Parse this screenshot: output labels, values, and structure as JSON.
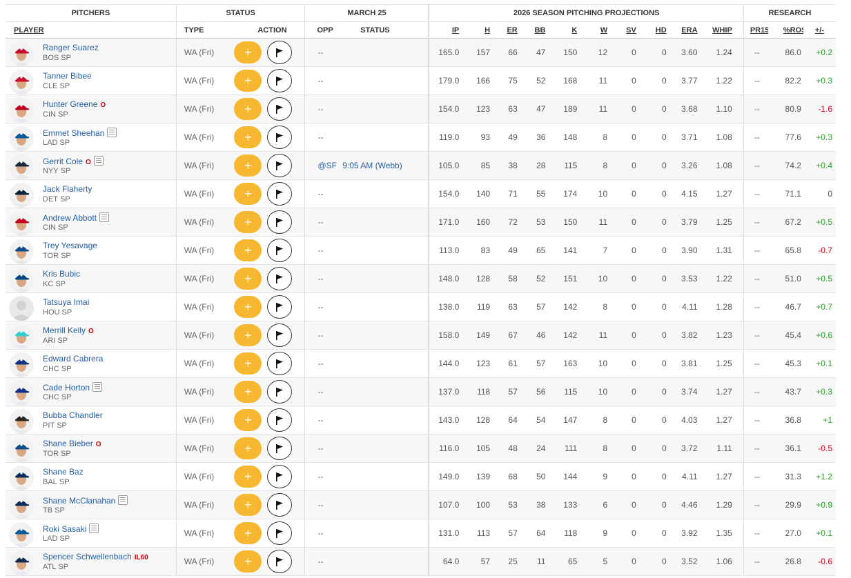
{
  "groups": {
    "pitchers": "PITCHERS",
    "status": "STATUS",
    "date": "MARCH 25",
    "projections": "2026 SEASON PITCHING PROJECTIONS",
    "research": "RESEARCH"
  },
  "columns": {
    "player": "PLAYER",
    "type": "TYPE",
    "action": "ACTION",
    "opp": "OPP",
    "status": "STATUS",
    "ip": "IP",
    "h": "H",
    "er": "ER",
    "bb": "BB",
    "k": "K",
    "w": "W",
    "sv": "SV",
    "hd": "HD",
    "era": "ERA",
    "whip": "WHIP",
    "pr15": "PR15",
    "rost": "%ROST",
    "pm": "+/-"
  },
  "action_labels": {
    "add": "+"
  },
  "colors": {
    "add_button": "#f7b731",
    "link": "#225ea8",
    "positive": "#2a9d2a",
    "negative": "#d0021b",
    "injury": "#cc0000"
  },
  "players": [
    {
      "name": "Ranger Suarez",
      "team": "BOS",
      "pos": "SP",
      "tag": "",
      "news": false,
      "type": "WA (Fri)",
      "opp": "--",
      "gstatus": "",
      "ip": "165.0",
      "h": "157",
      "er": "66",
      "bb": "47",
      "k": "150",
      "w": "12",
      "sv": "0",
      "hd": "0",
      "era": "3.60",
      "whip": "1.24",
      "pr15": "--",
      "rost": "86.0",
      "pm": "+0.2",
      "cap": "#c8102e"
    },
    {
      "name": "Tanner Bibee",
      "team": "CLE",
      "pos": "SP",
      "tag": "",
      "news": false,
      "type": "WA (Fri)",
      "opp": "--",
      "gstatus": "",
      "ip": "179.0",
      "h": "166",
      "er": "75",
      "bb": "52",
      "k": "168",
      "w": "11",
      "sv": "0",
      "hd": "0",
      "era": "3.77",
      "whip": "1.22",
      "pr15": "--",
      "rost": "82.2",
      "pm": "+0.3",
      "cap": "#c8102e"
    },
    {
      "name": "Hunter Greene",
      "team": "CIN",
      "pos": "SP",
      "tag": "O",
      "news": false,
      "type": "WA (Fri)",
      "opp": "--",
      "gstatus": "",
      "ip": "154.0",
      "h": "123",
      "er": "63",
      "bb": "47",
      "k": "189",
      "w": "11",
      "sv": "0",
      "hd": "0",
      "era": "3.68",
      "whip": "1.10",
      "pr15": "--",
      "rost": "80.9",
      "pm": "-1.6",
      "cap": "#c6011f"
    },
    {
      "name": "Emmet Sheehan",
      "team": "LAD",
      "pos": "SP",
      "tag": "",
      "news": true,
      "type": "WA (Fri)",
      "opp": "--",
      "gstatus": "",
      "ip": "119.0",
      "h": "93",
      "er": "49",
      "bb": "36",
      "k": "148",
      "w": "8",
      "sv": "0",
      "hd": "0",
      "era": "3.71",
      "whip": "1.08",
      "pr15": "--",
      "rost": "77.6",
      "pm": "+0.3",
      "cap": "#005a9c"
    },
    {
      "name": "Gerrit Cole",
      "team": "NYY",
      "pos": "SP",
      "tag": "O",
      "news": true,
      "type": "WA (Fri)",
      "opp": "@SF",
      "gstatus": "9:05 AM (Webb)",
      "ip": "105.0",
      "h": "85",
      "er": "38",
      "bb": "28",
      "k": "115",
      "w": "8",
      "sv": "0",
      "hd": "0",
      "era": "3.26",
      "whip": "1.08",
      "pr15": "--",
      "rost": "74.2",
      "pm": "+0.4",
      "cap": "#1c2841"
    },
    {
      "name": "Jack Flaherty",
      "team": "DET",
      "pos": "SP",
      "tag": "",
      "news": false,
      "type": "WA (Fri)",
      "opp": "--",
      "gstatus": "",
      "ip": "154.0",
      "h": "140",
      "er": "71",
      "bb": "55",
      "k": "174",
      "w": "10",
      "sv": "0",
      "hd": "0",
      "era": "4.15",
      "whip": "1.27",
      "pr15": "--",
      "rost": "71.1",
      "pm": "0",
      "cap": "#0c2340"
    },
    {
      "name": "Andrew Abbott",
      "team": "CIN",
      "pos": "SP",
      "tag": "",
      "news": true,
      "type": "WA (Fri)",
      "opp": "--",
      "gstatus": "",
      "ip": "171.0",
      "h": "160",
      "er": "72",
      "bb": "53",
      "k": "150",
      "w": "11",
      "sv": "0",
      "hd": "0",
      "era": "3.79",
      "whip": "1.25",
      "pr15": "--",
      "rost": "67.2",
      "pm": "+0.5",
      "cap": "#c6011f"
    },
    {
      "name": "Trey Yesavage",
      "team": "TOR",
      "pos": "SP",
      "tag": "",
      "news": false,
      "type": "WA (Fri)",
      "opp": "--",
      "gstatus": "",
      "ip": "113.0",
      "h": "83",
      "er": "49",
      "bb": "65",
      "k": "141",
      "w": "7",
      "sv": "0",
      "hd": "0",
      "era": "3.90",
      "whip": "1.31",
      "pr15": "--",
      "rost": "65.8",
      "pm": "-0.7",
      "cap": "#134a8e"
    },
    {
      "name": "Kris Bubic",
      "team": "KC",
      "pos": "SP",
      "tag": "",
      "news": false,
      "type": "WA (Fri)",
      "opp": "--",
      "gstatus": "",
      "ip": "148.0",
      "h": "128",
      "er": "58",
      "bb": "52",
      "k": "151",
      "w": "10",
      "sv": "0",
      "hd": "0",
      "era": "3.53",
      "whip": "1.22",
      "pr15": "--",
      "rost": "51.0",
      "pm": "+0.5",
      "cap": "#004687"
    },
    {
      "name": "Tatsuya Imai",
      "team": "HOU",
      "pos": "SP",
      "tag": "",
      "news": false,
      "type": "WA (Fri)",
      "opp": "--",
      "gstatus": "",
      "ip": "138.0",
      "h": "119",
      "er": "63",
      "bb": "57",
      "k": "142",
      "w": "8",
      "sv": "0",
      "hd": "0",
      "era": "4.11",
      "whip": "1.28",
      "pr15": "--",
      "rost": "46.7",
      "pm": "+0.7",
      "cap": ""
    },
    {
      "name": "Merrill Kelly",
      "team": "ARI",
      "pos": "SP",
      "tag": "O",
      "news": false,
      "type": "WA (Fri)",
      "opp": "--",
      "gstatus": "",
      "ip": "158.0",
      "h": "149",
      "er": "67",
      "bb": "46",
      "k": "142",
      "w": "11",
      "sv": "0",
      "hd": "0",
      "era": "3.82",
      "whip": "1.23",
      "pr15": "--",
      "rost": "45.4",
      "pm": "+0.6",
      "cap": "#30ced8"
    },
    {
      "name": "Edward Cabrera",
      "team": "CHC",
      "pos": "SP",
      "tag": "",
      "news": false,
      "type": "WA (Fri)",
      "opp": "--",
      "gstatus": "",
      "ip": "144.0",
      "h": "123",
      "er": "61",
      "bb": "57",
      "k": "163",
      "w": "10",
      "sv": "0",
      "hd": "0",
      "era": "3.81",
      "whip": "1.25",
      "pr15": "--",
      "rost": "45.3",
      "pm": "+0.1",
      "cap": "#0e3386"
    },
    {
      "name": "Cade Horton",
      "team": "CHC",
      "pos": "SP",
      "tag": "",
      "news": true,
      "type": "WA (Fri)",
      "opp": "--",
      "gstatus": "",
      "ip": "137.0",
      "h": "118",
      "er": "57",
      "bb": "56",
      "k": "115",
      "w": "10",
      "sv": "0",
      "hd": "0",
      "era": "3.74",
      "whip": "1.27",
      "pr15": "--",
      "rost": "43.7",
      "pm": "+0.3",
      "cap": "#0e3386"
    },
    {
      "name": "Bubba Chandler",
      "team": "PIT",
      "pos": "SP",
      "tag": "",
      "news": false,
      "type": "WA (Fri)",
      "opp": "--",
      "gstatus": "",
      "ip": "143.0",
      "h": "128",
      "er": "64",
      "bb": "54",
      "k": "147",
      "w": "8",
      "sv": "0",
      "hd": "0",
      "era": "4.03",
      "whip": "1.27",
      "pr15": "--",
      "rost": "36.8",
      "pm": "+1",
      "cap": "#27251f"
    },
    {
      "name": "Shane Bieber",
      "team": "TOR",
      "pos": "SP",
      "tag": "O",
      "news": false,
      "type": "WA (Fri)",
      "opp": "--",
      "gstatus": "",
      "ip": "116.0",
      "h": "105",
      "er": "48",
      "bb": "24",
      "k": "111",
      "w": "8",
      "sv": "0",
      "hd": "0",
      "era": "3.72",
      "whip": "1.11",
      "pr15": "--",
      "rost": "36.1",
      "pm": "-0.5",
      "cap": "#134a8e"
    },
    {
      "name": "Shane Baz",
      "team": "BAL",
      "pos": "SP",
      "tag": "",
      "news": false,
      "type": "WA (Fri)",
      "opp": "--",
      "gstatus": "",
      "ip": "149.0",
      "h": "139",
      "er": "68",
      "bb": "50",
      "k": "144",
      "w": "9",
      "sv": "0",
      "hd": "0",
      "era": "4.11",
      "whip": "1.27",
      "pr15": "--",
      "rost": "31.3",
      "pm": "+1.2",
      "cap": "#092c5c"
    },
    {
      "name": "Shane McClanahan",
      "team": "TB",
      "pos": "SP",
      "tag": "",
      "news": true,
      "type": "WA (Fri)",
      "opp": "--",
      "gstatus": "",
      "ip": "107.0",
      "h": "100",
      "er": "53",
      "bb": "38",
      "k": "133",
      "w": "6",
      "sv": "0",
      "hd": "0",
      "era": "4.46",
      "whip": "1.29",
      "pr15": "--",
      "rost": "29.9",
      "pm": "+0.9",
      "cap": "#092c5c"
    },
    {
      "name": "Roki Sasaki",
      "team": "LAD",
      "pos": "SP",
      "tag": "",
      "news": true,
      "type": "WA (Fri)",
      "opp": "--",
      "gstatus": "",
      "ip": "131.0",
      "h": "113",
      "er": "57",
      "bb": "64",
      "k": "118",
      "w": "9",
      "sv": "0",
      "hd": "0",
      "era": "3.92",
      "whip": "1.35",
      "pr15": "--",
      "rost": "27.0",
      "pm": "+0.1",
      "cap": "#005a9c"
    },
    {
      "name": "Spencer Schwellenbach",
      "team": "ATL",
      "pos": "SP",
      "tag": "IL60",
      "news": false,
      "type": "WA (Fri)",
      "opp": "--",
      "gstatus": "",
      "ip": "64.0",
      "h": "57",
      "er": "25",
      "bb": "11",
      "k": "65",
      "w": "5",
      "sv": "0",
      "hd": "0",
      "era": "3.52",
      "whip": "1.06",
      "pr15": "--",
      "rost": "26.8",
      "pm": "-0.6",
      "cap": "#13274f"
    }
  ]
}
